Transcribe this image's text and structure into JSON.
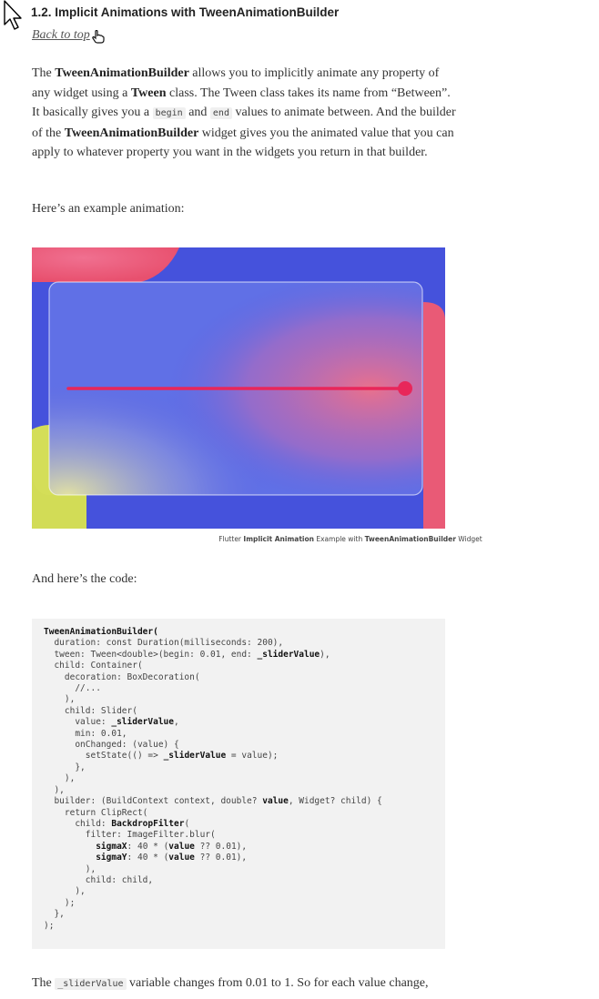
{
  "section": {
    "title": "1.2. Implicit Animations with TweenAnimationBuilder",
    "back_link": "Back to top"
  },
  "intro": {
    "p1_a": "The ",
    "p1_b": "TweenAnimationBuilder",
    "p1_c": " allows you to implicitly animate any property of any widget using a ",
    "p1_d": "Tween",
    "p1_e": " class. The Tween class takes its name from “Between”. It basically gives you a ",
    "code_begin": "begin",
    "p1_f": " and ",
    "code_end": "end",
    "p1_g": " values to animate between. And the builder of the ",
    "p1_h": "TweenAnimationBuilder",
    "p1_i": " widget gives you the animated value that you can apply to whatever property you want in the widgets you return in that builder.",
    "p2": "Here’s an example animation:"
  },
  "figure": {
    "caption_a": "Flutter ",
    "caption_b": "Implicit Animation",
    "caption_c": " Example with ",
    "caption_d": "TweenAnimationBuilder",
    "caption_e": " Widget",
    "slider_value": 1.0,
    "colors": {
      "background": "#4552dc",
      "pink": "#e8607a",
      "yellow": "#d8e060",
      "slider": "#e8265a"
    }
  },
  "code_intro": "And here’s the code:",
  "code": {
    "l1": "TweenAnimationBuilder(",
    "l2": "  duration: const Duration(milliseconds: 200),",
    "l3a": "  tween: Tween<double>(begin: 0.01, end: ",
    "l3b": "_sliderValue",
    "l3c": "),",
    "l4": "  child: Container(",
    "l5": "    decoration: BoxDecoration(",
    "l6": "      //...",
    "l7": "    ),",
    "l8": "    child: Slider(",
    "l9a": "      value: ",
    "l9b": "_sliderValue",
    "l9c": ",",
    "l10": "      min: 0.01,",
    "l11": "      onChanged: (value) {",
    "l12a": "        setState(() => ",
    "l12b": "_sliderValue",
    "l12c": " = value);",
    "l13": "      },",
    "l14": "    ),",
    "l15": "  ),",
    "l16a": "  builder: (BuildContext context, double? ",
    "l16b": "value",
    "l16c": ", Widget? child) {",
    "l17": "    return ClipRect(",
    "l18a": "      child: ",
    "l18b": "BackdropFilter",
    "l18c": "(",
    "l19": "        filter: ImageFilter.blur(",
    "l20a": "          ",
    "l20b": "sigmaX",
    "l20c": ": 40 * (",
    "l20d": "value",
    "l20e": " ?? 0.01),",
    "l21a": "          ",
    "l21b": "sigmaY",
    "l21c": ": 40 * (",
    "l21d": "value",
    "l21e": " ?? 0.01),",
    "l22": "        ),",
    "l23": "        child: child,",
    "l24": "      ),",
    "l25": "    );",
    "l26": "  },",
    "l27": ");"
  },
  "outro": {
    "a": "The ",
    "code": "_sliderValue",
    "b": " variable changes from 0.01 to 1. So for each value change,"
  }
}
